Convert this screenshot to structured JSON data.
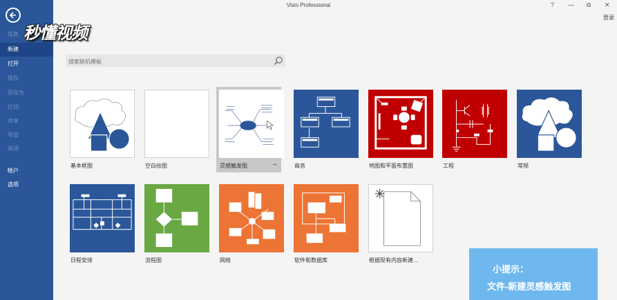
{
  "titlebar": {
    "app_title": "Visio Professional",
    "help": "?",
    "minimize": "—",
    "restore": "⧉",
    "close": "✕",
    "signin": "登录"
  },
  "watermark": "秒懂视频",
  "sidebar": {
    "items": [
      {
        "label": "信息",
        "dim": true
      },
      {
        "label": "新建",
        "active": true
      },
      {
        "label": "打开"
      },
      {
        "label": "保存",
        "dim": true
      },
      {
        "label": "另存为",
        "dim": true
      },
      {
        "label": "打印",
        "dim": true
      },
      {
        "label": "共享",
        "dim": true
      },
      {
        "label": "导出",
        "dim": true
      },
      {
        "label": "关闭",
        "dim": true
      },
      {
        "label": "帐户"
      },
      {
        "label": "选项"
      }
    ]
  },
  "search": {
    "placeholder": "搜索联机模板"
  },
  "templates": [
    {
      "label": "基本框图"
    },
    {
      "label": "空白绘图"
    },
    {
      "label": "灵感触发图",
      "selected": true
    },
    {
      "label": "商务"
    },
    {
      "label": "地图和平面布置图"
    },
    {
      "label": "工程"
    },
    {
      "label": "常规"
    },
    {
      "label": "日程安排"
    },
    {
      "label": "流程图"
    },
    {
      "label": "网络"
    },
    {
      "label": "软件和数据库"
    },
    {
      "label": "根据现有内容新建..."
    }
  ],
  "hint": {
    "line1": "小提示：",
    "line2": "文件-新建灵感触发图"
  },
  "colors": {
    "sidebar": "#2b579a",
    "business_blue": "#2b579a",
    "engineering_red": "#c00000",
    "flow_green": "#6aa843",
    "network_orange": "#ec7434",
    "hint_blue": "#6fb8ef"
  }
}
